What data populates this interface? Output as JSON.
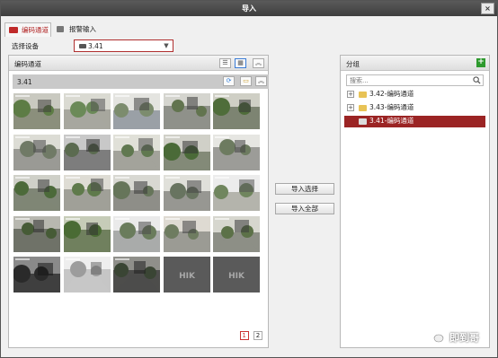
{
  "window": {
    "title": "导入",
    "close_label": "×"
  },
  "tabs": [
    {
      "label": "编码通道",
      "icon": "camera-icon",
      "active": true
    },
    {
      "label": "报警输入",
      "icon": "alarm-input-icon",
      "active": false
    }
  ],
  "device": {
    "label": "选择设备",
    "value": "3.41",
    "icon": "dvr-device-icon"
  },
  "left_panel": {
    "title": "编码通道",
    "subtitle": "3.41",
    "view_buttons": [
      "list-view-icon",
      "thumbnail-view-icon",
      "collapse-icon"
    ],
    "sub_buttons": [
      "refresh-icon",
      "folder-icon",
      "collapse-icon"
    ],
    "thumbnails": [
      {
        "scene": "courtyard-green"
      },
      {
        "scene": "road-building"
      },
      {
        "scene": "building-facade"
      },
      {
        "scene": "gate-road"
      },
      {
        "scene": "alley-trees"
      },
      {
        "scene": "yard-wall"
      },
      {
        "scene": "street-night"
      },
      {
        "scene": "parking-lot"
      },
      {
        "scene": "trees-road"
      },
      {
        "scene": "yard-car"
      },
      {
        "scene": "entrance-trees"
      },
      {
        "scene": "driveway"
      },
      {
        "scene": "parking-aerial"
      },
      {
        "scene": "corner-wall"
      },
      {
        "scene": "bright-street"
      },
      {
        "scene": "dark-yard"
      },
      {
        "scene": "garden-green"
      },
      {
        "scene": "white-building"
      },
      {
        "scene": "plaza"
      },
      {
        "scene": "wall-tree"
      },
      {
        "scene": "dark-corner"
      },
      {
        "scene": "grey-room"
      },
      {
        "scene": "dark-courtyard"
      },
      {
        "scene": "no-video",
        "brand": "HIK"
      },
      {
        "scene": "no-video",
        "brand": "HIK"
      }
    ],
    "pages": [
      "1",
      "2"
    ],
    "current_page": "1"
  },
  "middle": {
    "import_selected": "导入选择",
    "import_all": "导入全部"
  },
  "right_panel": {
    "title": "分组",
    "add_icon": "add-group-icon",
    "search_placeholder": "搜索...",
    "groups": [
      {
        "label": "3.42-编码通道",
        "expander": "+",
        "selected": false
      },
      {
        "label": "3.43-编码通道",
        "expander": "+",
        "selected": false
      },
      {
        "label": "3.41-编码通道",
        "expander": "",
        "selected": true
      }
    ]
  },
  "watermark": {
    "text": "即到哥"
  },
  "colors": {
    "accent_red": "#9b2424",
    "tab_active_text": "#b01f1f",
    "add_green": "#2e9a2e",
    "titlebar": "#4a4a4a"
  }
}
